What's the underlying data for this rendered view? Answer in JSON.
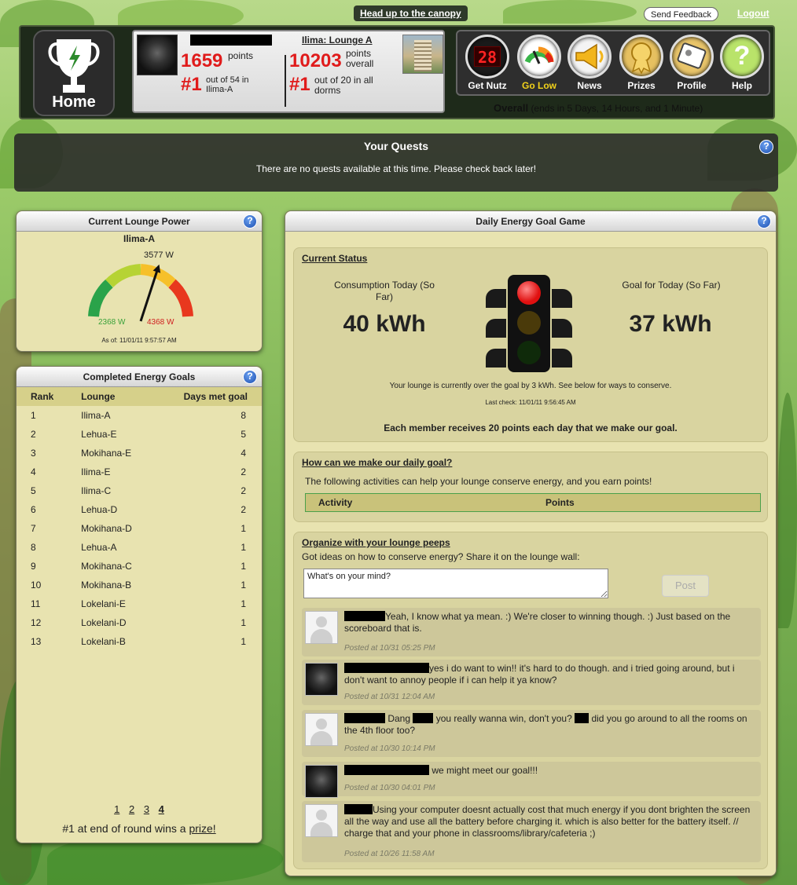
{
  "top": {
    "canopy_link": "Head up to the canopy",
    "feedback": "Send Feedback",
    "logout": "Logout"
  },
  "home": {
    "label": "Home"
  },
  "scoreboard": {
    "points": "1659",
    "points_label": "points",
    "rank": "#1",
    "rank_label": "out of 54 in Ilima-A",
    "lounge_title": "Ilima: Lounge A",
    "lounge_points": "10203",
    "lounge_points_label": "points overall",
    "lounge_rank": "#1",
    "lounge_rank_label": "out of 20 in all dorms"
  },
  "nav": {
    "items": [
      {
        "label": "Get Nutz",
        "icon": "counter-icon"
      },
      {
        "label": "Go Low",
        "icon": "meter-icon"
      },
      {
        "label": "News",
        "icon": "megaphone-icon"
      },
      {
        "label": "Prizes",
        "icon": "ribbon-icon"
      },
      {
        "label": "Profile",
        "icon": "id-card-icon"
      },
      {
        "label": "Help",
        "icon": "question-icon"
      }
    ],
    "counter_digits": "28",
    "active": "Go Low"
  },
  "overall": {
    "label": "Overall",
    "ends": "(ends in 5 Days, 14 Hours, and 1 Minute)"
  },
  "quests": {
    "title": "Your Quests",
    "message": "There are no quests available at this time. Please check back later!"
  },
  "lounge_power": {
    "title": "Current Lounge Power",
    "lounge": "Ilima-A",
    "current": "3577 W",
    "min": "2368 W",
    "max": "4368 W",
    "as_of": "As of: 11/01/11 9:57:57 AM",
    "level": 0.6
  },
  "energy_goals": {
    "title": "Completed Energy Goals",
    "columns": [
      "Rank",
      "Lounge",
      "Days met goal"
    ],
    "rows": [
      {
        "rank": "1",
        "lounge": "Ilima-A",
        "days": "8"
      },
      {
        "rank": "2",
        "lounge": "Lehua-E",
        "days": "5"
      },
      {
        "rank": "3",
        "lounge": "Mokihana-E",
        "days": "4"
      },
      {
        "rank": "4",
        "lounge": "Ilima-E",
        "days": "2"
      },
      {
        "rank": "5",
        "lounge": "Ilima-C",
        "days": "2"
      },
      {
        "rank": "6",
        "lounge": "Lehua-D",
        "days": "2"
      },
      {
        "rank": "7",
        "lounge": "Mokihana-D",
        "days": "1"
      },
      {
        "rank": "8",
        "lounge": "Lehua-A",
        "days": "1"
      },
      {
        "rank": "9",
        "lounge": "Mokihana-C",
        "days": "1"
      },
      {
        "rank": "10",
        "lounge": "Mokihana-B",
        "days": "1"
      },
      {
        "rank": "11",
        "lounge": "Lokelani-E",
        "days": "1"
      },
      {
        "rank": "12",
        "lounge": "Lokelani-D",
        "days": "1"
      },
      {
        "rank": "13",
        "lounge": "Lokelani-B",
        "days": "1"
      }
    ],
    "pages": [
      "1",
      "2",
      "3",
      "4"
    ],
    "prize_prefix": "#1 at end of round wins a ",
    "prize_link": "prize!"
  },
  "daily_goal": {
    "title": "Daily Energy Goal Game",
    "status_title": "Current Status",
    "consumption_label": "Consumption Today (So Far)",
    "consumption_value": "40 kWh",
    "goal_label": "Goal for Today (So Far)",
    "goal_value": "37 kWh",
    "status_msg": "Your lounge is currently over the goal by 3 kWh. See below for ways to conserve.",
    "last_check": "Last check: 11/01/11 9:56:45 AM",
    "reward_msg": "Each member receives 20 points each day that we make our goal.",
    "light_colors": {
      "red": "#e01010",
      "yellow": "#4a3a0a",
      "green": "#0f2a0a"
    }
  },
  "make_goal": {
    "title": "How can we make our daily goal?",
    "desc": "The following activities can help your lounge conserve energy, and you earn points!",
    "columns": [
      "Activity",
      "Points"
    ]
  },
  "organize": {
    "title": "Organize with your lounge peeps",
    "desc": "Got ideas on how to conserve energy? Share it on the lounge wall:",
    "placeholder": "What's on your mind?",
    "post_label": "Post",
    "comments": [
      {
        "avatar": "blank",
        "text": "Yeah, I know what ya mean. :) We're closer to winning though. :) Just based on the scoreboard that is.",
        "time": "Posted at 10/31 05:25 PM"
      },
      {
        "avatar": "gorilla",
        "text": "yes i do want to win!! it's hard to do though. and i tried going around, but i don't want to annoy people if i can help it ya know?",
        "time": "Posted at 10/31 12:04 AM"
      },
      {
        "avatar": "blank",
        "text_parts": [
          "Dang",
          "you really wanna win, don't you?",
          "did you go around to all the rooms on the 4th floor too?"
        ],
        "time": "Posted at 10/30 10:14 PM"
      },
      {
        "avatar": "gorilla",
        "text": "we might meet our goal!!!",
        "time": "Posted at 10/30 04:01 PM"
      },
      {
        "avatar": "blank",
        "text": "Using your computer doesnt actually cost that much energy if you dont brighten the screen all the way and use all the battery before charging it. which is also better for the battery itself. // charge that and your phone in classrooms/library/cafeteria ;)",
        "time": "Posted at 10/26 11:58 AM"
      }
    ]
  }
}
